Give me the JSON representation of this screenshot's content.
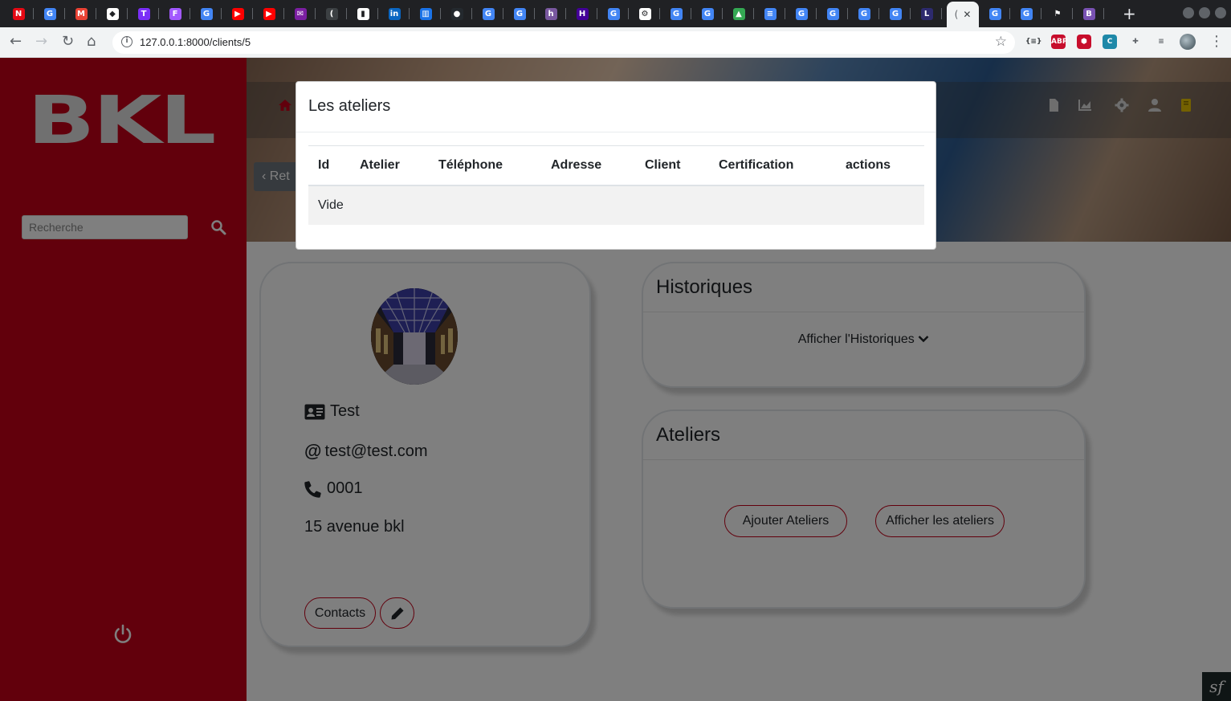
{
  "browser": {
    "tabs": [
      {
        "icon": "netflix-icon",
        "glyph": "N",
        "color": "#e50914"
      },
      {
        "icon": "google-icon",
        "glyph": "G",
        "color": "#4285f4"
      },
      {
        "icon": "gmail-icon",
        "glyph": "M",
        "color": "#ea4335"
      },
      {
        "icon": "diamond-icon",
        "glyph": "◆",
        "color": "#ffffff"
      },
      {
        "icon": "purple-tool-icon",
        "glyph": "T",
        "color": "#7b2ff7"
      },
      {
        "icon": "figma-icon",
        "glyph": "F",
        "color": "#a259ff"
      },
      {
        "icon": "google-icon",
        "glyph": "G",
        "color": "#4285f4"
      },
      {
        "icon": "youtube-icon",
        "glyph": "▶",
        "color": "#ff0000"
      },
      {
        "icon": "youtube-icon",
        "glyph": "▶",
        "color": "#ff0000"
      },
      {
        "icon": "mail-icon",
        "glyph": "✉",
        "color": "#7b1fa2"
      },
      {
        "icon": "audio-tab-icon",
        "glyph": "(",
        "color": "#3c4043"
      },
      {
        "icon": "file-icon",
        "glyph": "▮",
        "color": "#ffffff"
      },
      {
        "icon": "linkedin-icon",
        "glyph": "in",
        "color": "#0a66c2"
      },
      {
        "icon": "analytics-icon",
        "glyph": "▥",
        "color": "#1a73e8"
      },
      {
        "icon": "github-icon",
        "glyph": "●",
        "color": "#24292e"
      },
      {
        "icon": "google-icon",
        "glyph": "G",
        "color": "#4285f4"
      },
      {
        "icon": "google-icon",
        "glyph": "G",
        "color": "#4285f4"
      },
      {
        "icon": "heroku-icon",
        "glyph": "h",
        "color": "#79589f"
      },
      {
        "icon": "heroku-icon",
        "glyph": "H",
        "color": "#430098"
      },
      {
        "icon": "google-icon",
        "glyph": "G",
        "color": "#4285f4"
      },
      {
        "icon": "settings-tab-icon",
        "glyph": "⚙",
        "color": "#ffffff"
      },
      {
        "icon": "google-icon",
        "glyph": "G",
        "color": "#4285f4"
      },
      {
        "icon": "google-icon",
        "glyph": "G",
        "color": "#4285f4"
      },
      {
        "icon": "drive-icon",
        "glyph": "▲",
        "color": "#34a853"
      },
      {
        "icon": "docs-icon",
        "glyph": "≡",
        "color": "#4285f4"
      },
      {
        "icon": "google-icon",
        "glyph": "G",
        "color": "#4285f4"
      },
      {
        "icon": "google-icon",
        "glyph": "G",
        "color": "#4285f4"
      },
      {
        "icon": "google-icon",
        "glyph": "G",
        "color": "#4285f4"
      },
      {
        "icon": "google-icon",
        "glyph": "G",
        "color": "#4285f4"
      },
      {
        "icon": "lunar-icon",
        "glyph": "L",
        "color": "#2d2a6e"
      }
    ],
    "active_tab_glyph": "(",
    "tabs_after": [
      {
        "icon": "google-icon",
        "glyph": "G",
        "color": "#4285f4"
      },
      {
        "icon": "google-icon",
        "glyph": "G",
        "color": "#4285f4"
      },
      {
        "icon": "flag-icon",
        "glyph": "⚑",
        "color": "#202124"
      },
      {
        "icon": "bootstrap-icon",
        "glyph": "B",
        "color": "#7952b3"
      }
    ],
    "url": "127.0.0.1:8000/clients/5",
    "extensions": [
      {
        "icon": "json-viewer-icon",
        "glyph": "{≡}",
        "color": "#3c4043"
      },
      {
        "icon": "adblock-icon",
        "glyph": "ABP",
        "color": "#c70d2c"
      },
      {
        "icon": "ublock-icon",
        "glyph": "⬢",
        "color": "#c70d2c"
      },
      {
        "icon": "refresh-ext-icon",
        "glyph": "C",
        "color": "#1e88a8"
      },
      {
        "icon": "puzzle-icon",
        "glyph": "✚",
        "color": "#5f6368"
      },
      {
        "icon": "media-queue-icon",
        "glyph": "≡",
        "color": "#5f6368"
      }
    ]
  },
  "sidebar": {
    "logo": "BKL",
    "search_placeholder": "Recherche"
  },
  "header": {
    "back_label": "Ret"
  },
  "profile": {
    "name": "Test",
    "email": "test@test.com",
    "phone": "0001",
    "address": "15 avenue bkl",
    "contacts_label": "Contacts"
  },
  "historiques": {
    "title": "Historiques",
    "toggle_label": "Afficher l'Historiques"
  },
  "ateliers": {
    "title": "Ateliers",
    "add_label": "Ajouter Ateliers",
    "show_label": "Afficher les ateliers"
  },
  "modal": {
    "title": "Les ateliers",
    "columns": [
      "Id",
      "Atelier",
      "Téléphone",
      "Adresse",
      "Client",
      "Certification",
      "actions"
    ],
    "empty_text": "Vide"
  },
  "colors": {
    "brand_red": "#c40019",
    "hero_icon_accent": "#e8c200",
    "home_icon": "#c40019"
  }
}
